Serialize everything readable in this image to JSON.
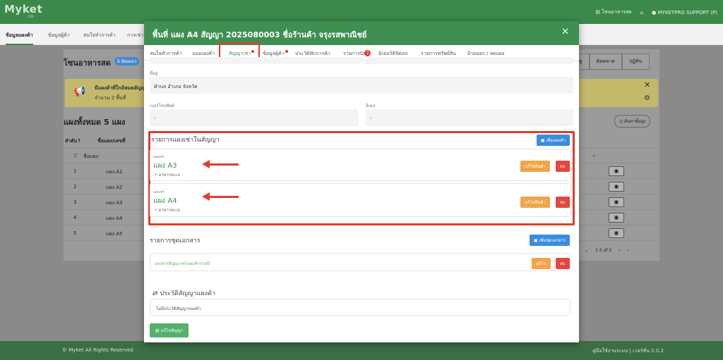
{
  "app": {
    "logo": "Myket",
    "logo_sub": "co",
    "top_right": {
      "zone": "โซนอาหารสด",
      "user": "MYKETPRO SUPPORT (P)"
    }
  },
  "subnav": [
    "ข้อมูลแผงค้า",
    "ข้อมูลผู้ค้า",
    "สนใจทำการค้า",
    "การเช่า"
  ],
  "background": {
    "zone_title": "โซนอาหารสด",
    "zone_badge": "5 ห้องแถว",
    "alert_title": "มีแผงค้าที่ใกล้หมดสัญญา",
    "alert_sub": "จำนวน 2 พื้นที่",
    "count_title": "แผงทั้งหมด 5 แผง",
    "tabs": [
      "ดู",
      "ติดตลาด",
      "ปฏิทิน"
    ],
    "filter_btn": "ค้นหาขั้นสูง",
    "table_headers": [
      "ลำดับ↑",
      "ชื่อแผง/เลขที่"
    ],
    "filter_row": "ชื่อแผง",
    "rows": [
      {
        "no": "1",
        "name": "แผง A1"
      },
      {
        "no": "2",
        "name": "แผง A2"
      },
      {
        "no": "3",
        "name": "แผง A3"
      },
      {
        "no": "4",
        "name": "แผง A4"
      },
      {
        "no": "5",
        "name": "แผง A5"
      }
    ],
    "pager": "1-5 of 5"
  },
  "modal": {
    "title": "พื้นที่ แผง A4 สัญญา 2025080003 ชื่อร้านค้า จรุงรสพาณิชย์",
    "tabs": [
      "สนใจทำการค้า",
      "จองแผงค้า",
      "สัญญาเช่า",
      "ข้อมูลผู้ค้า",
      "ประวัติพักการค้า",
      "รายการบิล",
      "มิเตอร์ดิจิตอล",
      "รายการทรัพย์สิน",
      "ย้ายออก / ลดแผง"
    ],
    "bill_badge": "1",
    "address_label": "ที่อยู่",
    "address_value": "ตำบล อำเภอ จังหวัด",
    "phone_label": "เบอร์โทรศัพท์",
    "phone_value": "-",
    "email_label": "อีเมล",
    "email_value": "-",
    "stalls_section_title": "รายการแผงเช่าในสัญญา",
    "add_stall_btn": "เพิ่มแผงค้า",
    "stalls": [
      {
        "sub": "แผงเช่า",
        "name": "แผง A3",
        "category": "อาหารทะเล",
        "edit": "แก้ไขสินค้า",
        "delete": "ลบ"
      },
      {
        "sub": "แผงเช่า",
        "name": "แผง A4",
        "category": "อาหารทะเล",
        "edit": "แก้ไขสินค้า",
        "delete": "ลบ"
      }
    ],
    "docs_section_title": "รายการชุดเอกสาร",
    "add_doc_btn": "เพิ่มชุดเอกสาร",
    "doc_link": "เอกสารสัญญาเช่าแผงค้ารายปี",
    "doc_edit": "แก้ไข",
    "doc_delete": "ลบ",
    "history_title": "ประวัติสัญญาแผงค้า",
    "history_empty": "ไม่มีประวัติสัญญาแผงค้า",
    "edit_contract_btn": "แก้ไขสัญญา"
  },
  "footer": {
    "left": "© MyKet All Rights Reserved",
    "right": "คู่มือใช้งานระบบ | เวอร์ชั่น 2.0.2"
  },
  "colors": {
    "brand_green": "#3f8f53",
    "highlight_red": "#e53a2c",
    "primary_blue": "#3a8dde",
    "warning_orange": "#f0a54a"
  }
}
